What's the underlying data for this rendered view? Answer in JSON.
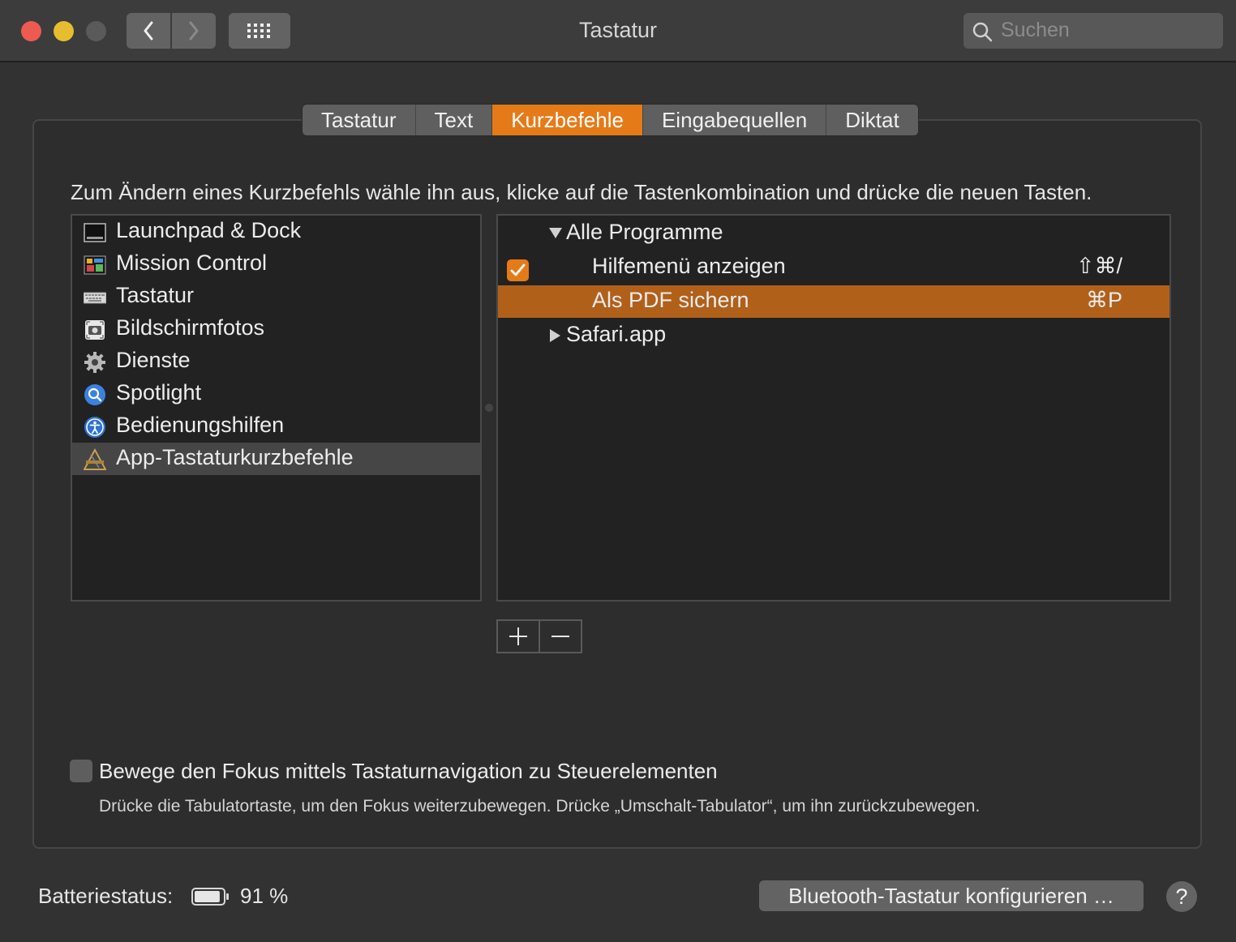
{
  "window": {
    "title": "Tastatur",
    "search_placeholder": "Suchen"
  },
  "tabs": [
    {
      "label": "Tastatur",
      "active": false
    },
    {
      "label": "Text",
      "active": false
    },
    {
      "label": "Kurzbefehle",
      "active": true
    },
    {
      "label": "Eingabequellen",
      "active": false
    },
    {
      "label": "Diktat",
      "active": false
    }
  ],
  "instruction": "Zum Ändern eines Kurzbefehls wähle ihn aus, klicke auf die Tastenkombination und drücke die neuen Tasten.",
  "categories": [
    {
      "label": "Launchpad & Dock",
      "icon": "launchpad-dock-icon"
    },
    {
      "label": "Mission Control",
      "icon": "mission-control-icon"
    },
    {
      "label": "Tastatur",
      "icon": "keyboard-icon"
    },
    {
      "label": "Bildschirmfotos",
      "icon": "screenshot-icon"
    },
    {
      "label": "Dienste",
      "icon": "gear-icon"
    },
    {
      "label": "Spotlight",
      "icon": "spotlight-icon"
    },
    {
      "label": "Bedienungshilfen",
      "icon": "accessibility-icon"
    },
    {
      "label": "App-Tastaturkurzbefehle",
      "icon": "app-shortcuts-icon",
      "selected": true
    }
  ],
  "shortcuts": {
    "group_all": {
      "label": "Alle Programme",
      "expanded": true
    },
    "items": [
      {
        "label": "Hilfemenü anzeigen",
        "key": "⇧⌘/",
        "enabled": true
      },
      {
        "label": "Als PDF sichern",
        "key": "⌘P",
        "selected": true
      }
    ],
    "group_safari": {
      "label": "Safari.app",
      "expanded": false
    }
  },
  "controls": {
    "add_symbol": "+",
    "remove_symbol": "−"
  },
  "focus_option": {
    "label": "Bewege den Fokus mittels Tastaturnavigation zu Steuerelementen",
    "hint": "Drücke die Tabulatortaste, um den Fokus weiterzubewegen. Drücke „Umschalt-Tabulator“, um ihn zurückzubewegen.",
    "checked": false
  },
  "footer": {
    "battery_label": "Batteriestatus:",
    "battery_value": "91 %",
    "battery_level": 0.91,
    "bluetooth_button": "Bluetooth-Tastatur konfigurieren …",
    "help_symbol": "?"
  },
  "colors": {
    "accent": "#e57a18",
    "selection": "#b1601a",
    "close": "#ed5a52",
    "minimize": "#e6bd2f"
  }
}
